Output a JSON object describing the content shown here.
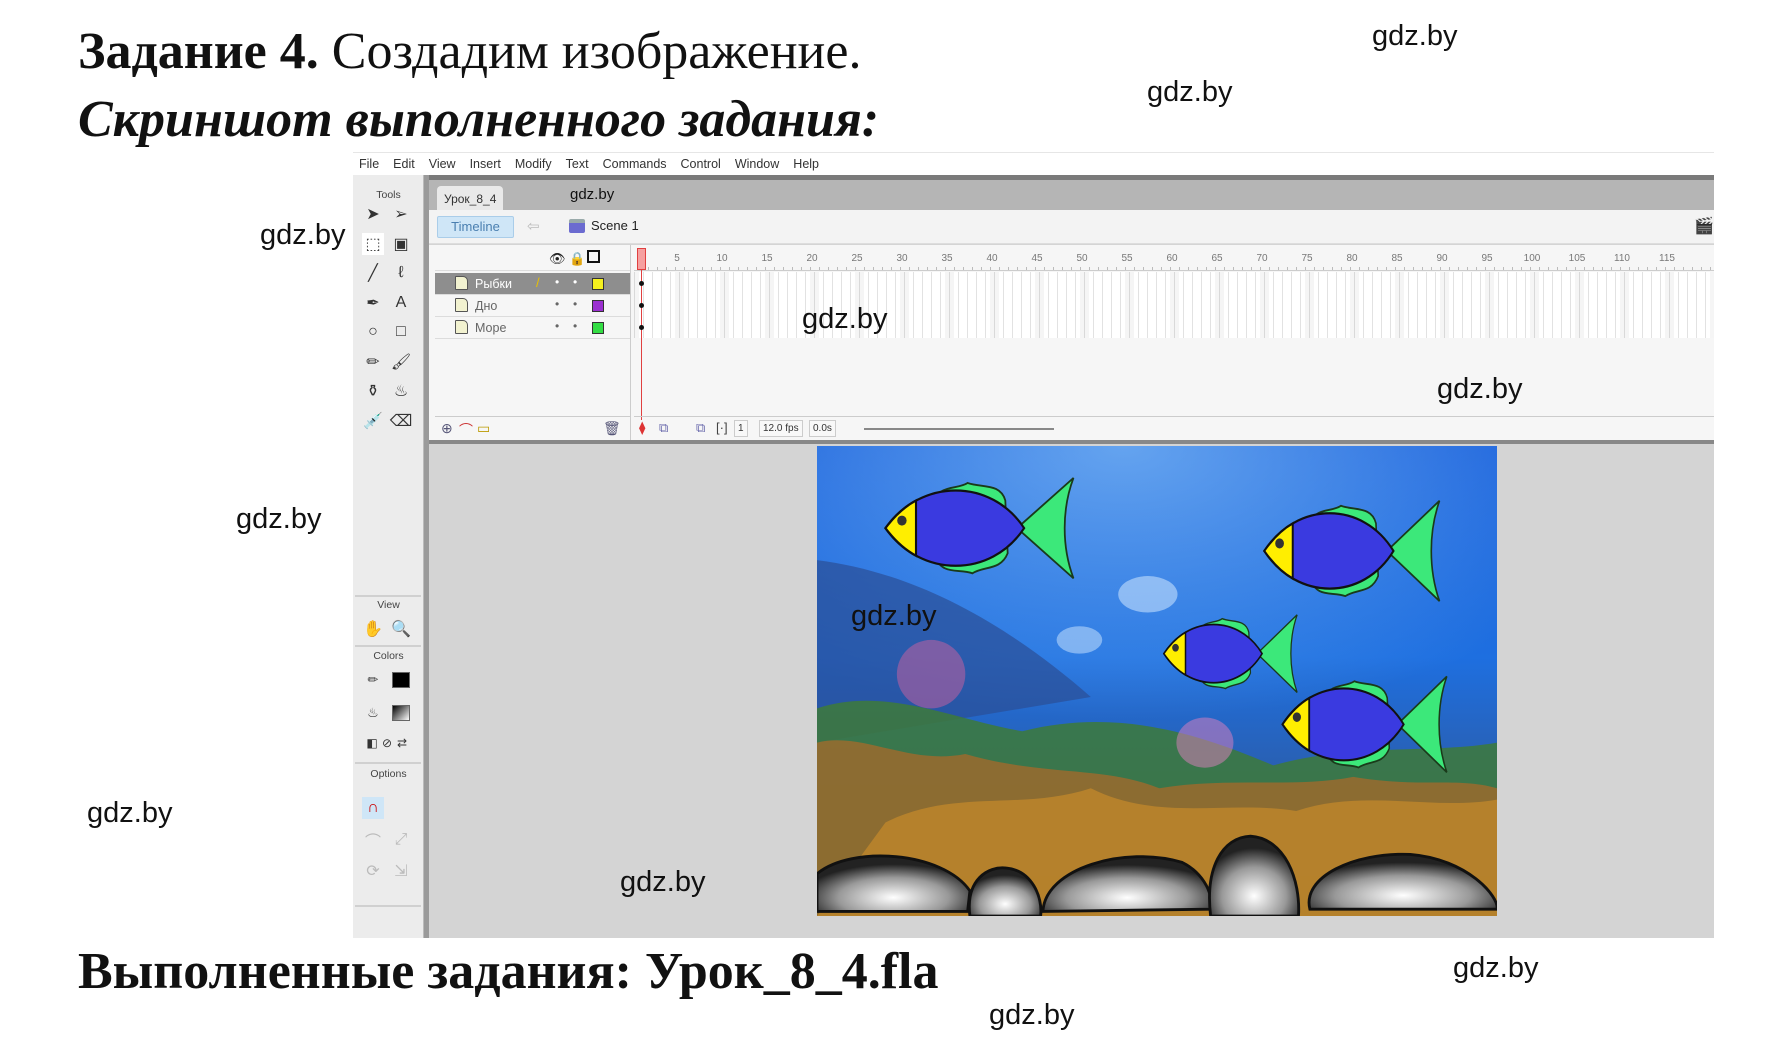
{
  "heading": {
    "task_bold": "Задание 4.",
    "task_rest": " Создадим изображение.",
    "subtitle": "Скриншот выполненного задания:",
    "footer": "Выполненные задания: Урок_8_4.fla"
  },
  "watermark": "gdz.by",
  "menu": [
    "File",
    "Edit",
    "View",
    "Insert",
    "Modify",
    "Text",
    "Commands",
    "Control",
    "Window",
    "Help"
  ],
  "tools": {
    "title": "Tools",
    "view_label": "View",
    "colors_label": "Colors",
    "options_label": "Options",
    "icons": [
      "selection-arrow",
      "subselection-arrow",
      "free-transform",
      "gradient-transform",
      "line",
      "lasso",
      "pen",
      "text",
      "oval",
      "rectangle",
      "pencil",
      "brush",
      "ink-bottle",
      "paint-bucket",
      "eyedropper",
      "eraser"
    ],
    "view_icons": [
      "hand",
      "zoom"
    ],
    "stroke_color": "#000000",
    "fill": "gradient",
    "option_icons": [
      "snap-magnet",
      "smooth",
      "straighten",
      "rotate",
      "scale"
    ]
  },
  "document": {
    "tab": "Урок_8_4",
    "timeline_button": "Timeline",
    "scene": "Scene 1"
  },
  "timeline": {
    "layers": [
      {
        "name": "Рыбки",
        "selected": true,
        "color": "#f5f01e"
      },
      {
        "name": "Дно",
        "selected": false,
        "color": "#9b30d0"
      },
      {
        "name": "Море",
        "selected": false,
        "color": "#33dd44"
      }
    ],
    "ruler_labels": [
      5,
      10,
      15,
      20,
      25,
      30,
      35,
      40,
      45,
      50,
      55,
      60,
      65,
      70,
      75,
      80,
      85,
      90,
      95,
      100,
      105,
      110,
      115
    ],
    "current_frame": "1",
    "fps": "12.0 fps",
    "time": "0.0s"
  },
  "stage": {
    "fish_count": 4,
    "stone_count": 5,
    "colors": {
      "body": "#3a3ae0",
      "fins": "#3ce87a",
      "head": "#ffee00",
      "water": "#1e6fe0"
    }
  }
}
